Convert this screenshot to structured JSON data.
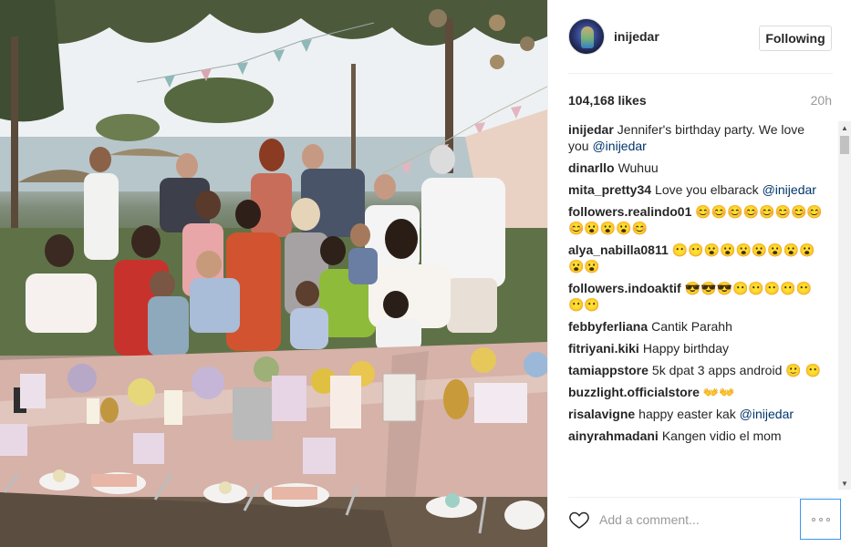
{
  "post": {
    "username": "inijedar",
    "follow_label": "Following",
    "likes": "104,168 likes",
    "time_ago": "20h",
    "comment_placeholder": "Add a comment..."
  },
  "photo": {
    "description_icon": "photo-image"
  },
  "comments": [
    {
      "user": "inijedar",
      "text": "Jennifer's birthday party. We love you",
      "mention": "@inijedar"
    },
    {
      "user": "dinarllo",
      "text": "Wuhuu",
      "mention": ""
    },
    {
      "user": "mita_pretty34",
      "text": "Love you elbarack",
      "mention": "@inijedar"
    },
    {
      "user": "followers.realindo01",
      "text": "😊😊😊😊😊😊😊😊😊😮😮😮😊",
      "mention": ""
    },
    {
      "user": "alya_nabilla0811",
      "text": "😶😶😮😮😮😮😮😮😮😮😮",
      "mention": ""
    },
    {
      "user": "followers.indoaktif",
      "text": "😎😎😎😶😶😶😶😶😶😶",
      "mention": ""
    },
    {
      "user": "febbyferliana",
      "text": "Cantik Parahh",
      "mention": ""
    },
    {
      "user": "fitriyani.kiki",
      "text": "Happy birthday",
      "mention": ""
    },
    {
      "user": "tamiappstore",
      "text": "5k dpat 3 apps android 🙂 😶",
      "mention": ""
    },
    {
      "user": "buzzlight.officialstore",
      "text": "👐👐",
      "mention": ""
    },
    {
      "user": "risalavigne",
      "text": "happy easter kak",
      "mention": "@inijedar"
    },
    {
      "user": "ainyrahmadani",
      "text": "Kangen vidio el mom",
      "mention": ""
    }
  ],
  "colors": {
    "link": "#003569",
    "muted": "#999999",
    "accent": "#3897f0"
  }
}
